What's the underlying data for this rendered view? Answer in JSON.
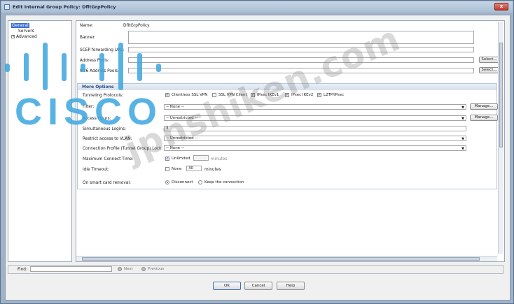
{
  "window": {
    "title": "Edit Internal Group Policy: DfltGrpPolicy",
    "close_glyph": "x"
  },
  "tree": {
    "items": [
      {
        "label": "General",
        "selected": true
      },
      {
        "label": "Servers"
      },
      {
        "label": "Advanced",
        "expander": "+"
      }
    ]
  },
  "form": {
    "name_label": "Name:",
    "name_value": "DfltGrpPolicy",
    "banner_label": "Banner:",
    "scep_label": "SCEP forwarding URL:",
    "address_pools_label": "Address Pools:",
    "ipv6_pools_label": "IPv6 Address Pools:",
    "select_label": "Select..."
  },
  "more_options": {
    "header": "More Options",
    "tunneling_label": "Tunneling Protocols:",
    "protocols": [
      {
        "label": "Clientless SSL VPN",
        "checked": true
      },
      {
        "label": "SSL VPN Client",
        "checked": false
      },
      {
        "label": "IPsec IKEv1",
        "checked": true
      },
      {
        "label": "IPsec IKEv2",
        "checked": true
      },
      {
        "label": "L2TP/IPsec",
        "checked": true
      }
    ],
    "filter_label": "Filter:",
    "filter_value": "-- None --",
    "manage_label": "Manage...",
    "access_hours_label": "Access Hours:",
    "access_hours_value": "-- Unrestricted --",
    "simultaneous_label": "Simultaneous Logins:",
    "simultaneous_value": "3",
    "vlan_label": "Restrict access to VLAN:",
    "vlan_value": "-- Unrestricted --",
    "lock_label": "Connection Profile (Tunnel Group) Lock:",
    "lock_value": "-- None --",
    "max_connect_label": "Maximum Connect Time:",
    "unlimited_label": "Unlimited",
    "minutes_label": "minutes",
    "idle_label": "Idle Timeout:",
    "none_label": "None",
    "idle_value": "30",
    "smartcard_label": "On smart card removal:",
    "disconnect_label": "Disconnect",
    "keep_label": "Keep the connection"
  },
  "findbar": {
    "label": "Find:",
    "next": "Next",
    "previous": "Previous"
  },
  "buttons": {
    "ok": "OK",
    "cancel": "Cancel",
    "help": "Help"
  },
  "watermark": "jpnshiken.com",
  "logo": {
    "word": "CISCO",
    "color": "#41a8e0"
  },
  "colors": {
    "selection": "#3a6fd0",
    "section_header": "#2b4e85"
  }
}
